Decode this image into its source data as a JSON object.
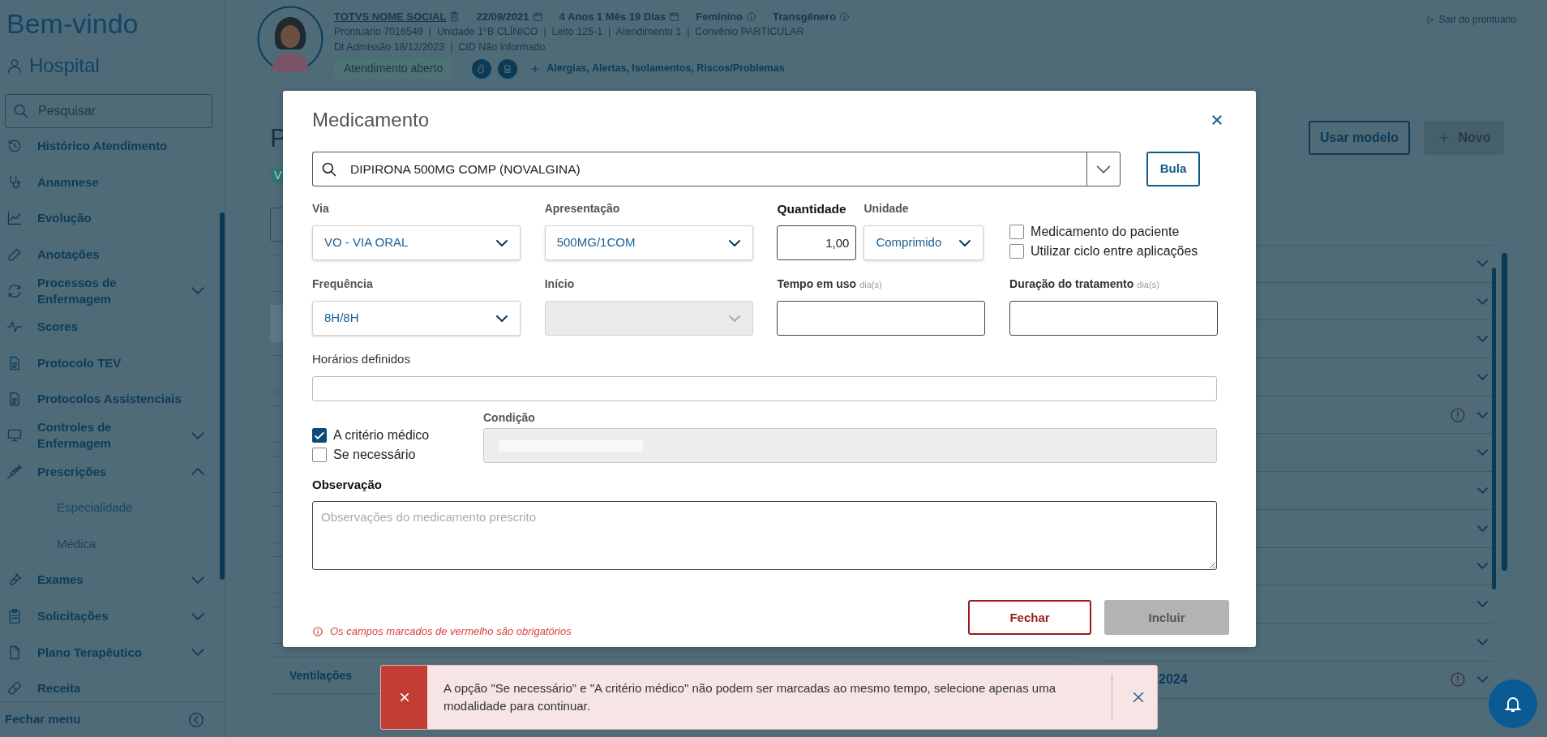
{
  "sidebar": {
    "title": "Bem-vindo",
    "user": "Hospital",
    "search": {
      "placeholder": "Pesquisar"
    },
    "items": [
      {
        "label": "Histórico Atendimento",
        "kind": "link"
      },
      {
        "label": "Anamnese",
        "kind": "link"
      },
      {
        "label": "Evolução",
        "kind": "link"
      },
      {
        "label": "Anotações",
        "kind": "link"
      },
      {
        "label": "Processos de Enfermagem",
        "kind": "group",
        "expanded": false
      },
      {
        "label": "Scores",
        "kind": "link"
      },
      {
        "label": "Protocolo TEV",
        "kind": "link"
      },
      {
        "label": "Protocolos Assistenciais",
        "kind": "link"
      },
      {
        "label": "Controles de Enfermagem",
        "kind": "group",
        "expanded": false
      },
      {
        "label": "Prescrições",
        "kind": "group",
        "expanded": true,
        "children": [
          {
            "label": "Especialidade"
          },
          {
            "label": "Médica"
          }
        ]
      },
      {
        "label": "Exames",
        "kind": "group",
        "expanded": false
      },
      {
        "label": "Solicitações",
        "kind": "group",
        "expanded": false
      },
      {
        "label": "Plano Terapêutico",
        "kind": "group",
        "expanded": false
      },
      {
        "label": "Receita",
        "kind": "link"
      }
    ],
    "footer": "Fechar menu"
  },
  "header": {
    "patient_name": "TOTVS NOME SOCIAL",
    "birth_date": "22/09/2021",
    "age": "4 Anos 1 Mês 19 Dias",
    "sex": "Feminino",
    "gender": "Transgênero",
    "details": [
      "Prontuário 7016549  |  Unidade 1°B CLÍNICO  |  Leito 125-1  |  Atendimento 1  |  Convênio PARTICULAR",
      "Dt Admissão 18/12/2023  |  CID Não informado"
    ],
    "status": "Atendimento aberto",
    "alerts_link": "Alergias, Alertas, Isolamentos, Riscos/Problemas",
    "exit_link": "Sair do prontuário"
  },
  "page": {
    "heading": "P",
    "badge": "V",
    "buttons": [
      {
        "label": "Usar modelo",
        "kind": "outline",
        "disabled": false
      },
      {
        "label": "Novo",
        "kind": "add",
        "disabled": true
      }
    ],
    "list_rows": [
      {
        "selected": false
      },
      {
        "selected": true
      },
      {
        "selected": false
      },
      {
        "selected": false
      },
      {
        "selected": false
      },
      {
        "selected": false
      },
      {
        "selected": false
      },
      {
        "selected": false
      },
      {
        "label": "Ventilações",
        "selected": false
      }
    ],
    "accordion_rows": [
      {
        "alert": false
      },
      {
        "alert": false
      },
      {
        "alert": false
      },
      {
        "alert": false
      },
      {
        "alert": true
      },
      {
        "alert": false
      },
      {
        "alert": false
      },
      {
        "alert": false
      },
      {
        "alert": false
      },
      {
        "alert": false
      },
      {
        "alert": false
      },
      {
        "alert": true,
        "label": "2024"
      }
    ]
  },
  "modal": {
    "title": "Medicamento",
    "search": {
      "value": "DIPIRONA 500MG COMP (NOVALGINA)"
    },
    "leaflet_button": "Bula",
    "via": {
      "label": "Via",
      "value": "VO - VIA ORAL"
    },
    "presentation": {
      "label": "Apresentação",
      "value": "500MG/1COM"
    },
    "quantity": {
      "label": "Quantidade",
      "value": "1,00"
    },
    "unit": {
      "label": "Unidade",
      "value": "Comprimido"
    },
    "options": [
      {
        "label": "Medicamento do paciente",
        "checked": false
      },
      {
        "label": "Utilizar ciclo entre aplicações",
        "checked": false
      }
    ],
    "frequency": {
      "label": "Frequência",
      "value": "8H/8H"
    },
    "start": {
      "label": "Início",
      "disabled": true
    },
    "time_in_use": {
      "label": "Tempo em uso",
      "unit": "dia(s)"
    },
    "duration": {
      "label": "Duração do tratamento",
      "unit": "dia(s)"
    },
    "schedules": {
      "label": "Horários definidos"
    },
    "modality": [
      {
        "label": "A critério médico",
        "checked": true
      },
      {
        "label": "Se necessário",
        "checked": false
      }
    ],
    "condition": {
      "label": "Condição",
      "disabled": true
    },
    "observation": {
      "label": "Observação",
      "placeholder": "Observações do medicamento prescrito"
    },
    "required_note": "Os campos marcados de vermelho são obrigatórios",
    "buttons": [
      {
        "label": "Fechar",
        "kind": "cancel",
        "disabled": false
      },
      {
        "label": "Incluir",
        "kind": "submit",
        "disabled": true
      }
    ]
  },
  "toast": {
    "message": "A opção \"Se necessário\" e \"A critério médico\" não podem ser marcadas ao mesmo tempo, selecione apenas uma modalidade para continuar."
  }
}
